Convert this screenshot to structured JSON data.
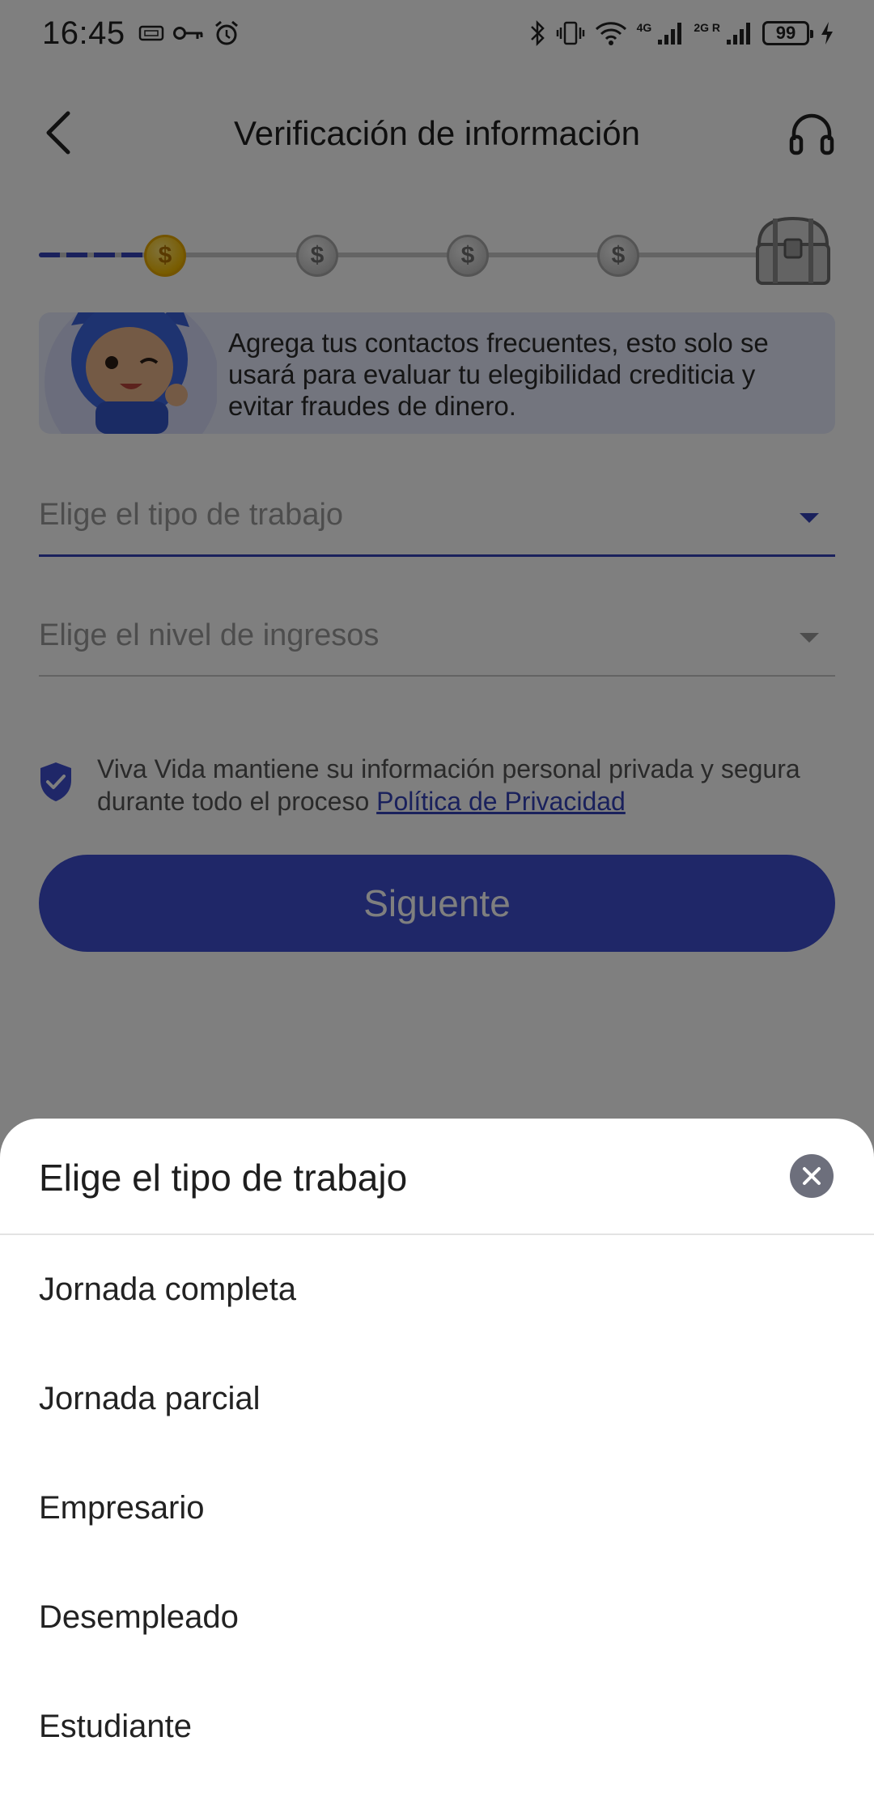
{
  "status_bar": {
    "time": "16:45",
    "network_label": "4G",
    "network_label_2": "2G R",
    "battery": "99",
    "icons": [
      "sim-icon",
      "key-icon",
      "alarm-icon",
      "bluetooth-icon",
      "vibrate-icon",
      "wifi-icon",
      "signal-icon",
      "signal-icon",
      "charging-icon"
    ]
  },
  "header": {
    "title": "Verificación de información",
    "back_icon": "chevron-left-icon",
    "support_icon": "headphones-icon"
  },
  "progress": {
    "steps_total": 5,
    "current_step": 1,
    "coin_symbol": "$",
    "reward_icon": "treasure-chest-icon"
  },
  "banner": {
    "text": "Agrega tus contactos frecuentes, esto solo se usará para evaluar tu elegibilidad crediticia y evitar fraudes de dinero."
  },
  "form": {
    "job_type_placeholder": "Elige el tipo de trabajo",
    "income_level_placeholder": "Elige el nivel de ingresos"
  },
  "privacy": {
    "text": "Viva Vida mantiene su información personal privada y segura durante todo el proceso ",
    "link": "Política de Privacidad"
  },
  "primary_button": {
    "label": "Siguente"
  },
  "sheet": {
    "title": "Elige el tipo de trabajo",
    "options": [
      {
        "label": "Jornada completa"
      },
      {
        "label": "Jornada parcial"
      },
      {
        "label": "Empresario"
      },
      {
        "label": "Desempleado"
      },
      {
        "label": "Estudiante"
      }
    ]
  },
  "colors": {
    "accent": "#3f4fd0",
    "accent_dark": "#3543b8",
    "banner_bg": "#e7eafc",
    "coin_active": "#f2b900",
    "scrim": "rgba(0,0,0,0.5)"
  }
}
